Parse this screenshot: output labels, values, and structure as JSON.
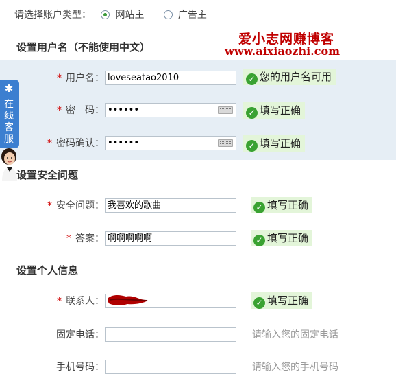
{
  "account_type": {
    "label": "请选择账户类型：",
    "options": [
      "网站主",
      "广告主"
    ],
    "selected": "网站主"
  },
  "watermark": {
    "title": "爱小志网赚博客",
    "url": "www.aixiaozhi.com"
  },
  "customer_service": {
    "label": "在线客服",
    "star_icon": "star-icon",
    "avatar_icon": "agent-avatar-icon"
  },
  "sections": {
    "username": "设置用户名（不能使用中文）",
    "security": "设置安全问题",
    "personal": "设置个人信息"
  },
  "fields": {
    "username": {
      "required": "*",
      "label": "用户名：",
      "value": "loveseatao2010",
      "status": "您的用户名可用"
    },
    "password": {
      "required": "*",
      "label": "密　码：",
      "value": "••••••",
      "status": "填写正确"
    },
    "password_confirm": {
      "required": "*",
      "label": "密码确认：",
      "value": "••••••",
      "status": "填写正确"
    },
    "security_question": {
      "required": "*",
      "label": "安全问题：",
      "value": "我喜欢的歌曲",
      "status": "填写正确"
    },
    "answer": {
      "required": "*",
      "label": "答案：",
      "value": "啊啊啊啊啊",
      "status": "填写正确"
    },
    "contact": {
      "required": "*",
      "label": "联系人：",
      "value": "",
      "status": "填写正确"
    },
    "phone": {
      "label": "固定电话：",
      "value": "",
      "hint": "请输入您的固定电话"
    },
    "mobile": {
      "label": "手机号码：",
      "value": "",
      "hint": "请输入您的手机号码"
    }
  },
  "colors": {
    "band_bg": "#e6eef5",
    "ok_bg": "#e3f5d9",
    "ok_icon": "#3aa232",
    "required": "#d00000",
    "watermark": "#c00000",
    "cs_tab": "#3c7fd0"
  }
}
